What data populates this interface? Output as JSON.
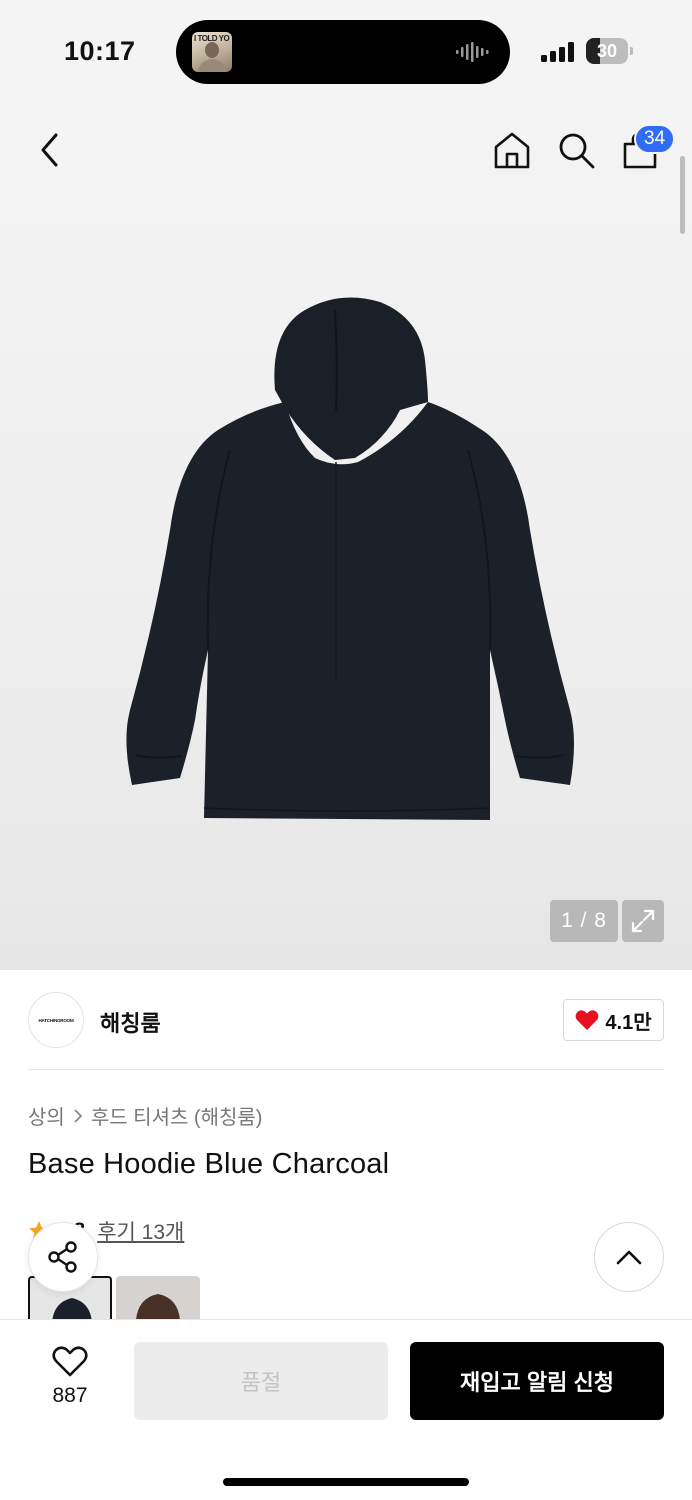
{
  "status_bar": {
    "time": "10:17",
    "battery": "30",
    "now_playing_art_text": "I TOLD YO"
  },
  "header": {
    "cart_count": "34",
    "icons": [
      "back-icon",
      "home-icon",
      "search-icon",
      "bag-icon"
    ]
  },
  "gallery": {
    "counter": "1 / 8",
    "expand_icon": "expand-icon"
  },
  "brand": {
    "logo_text": "HATCHINGROOM",
    "name": "해칭룸",
    "like_count": "4.1만",
    "heart_color": "#e8101e"
  },
  "product": {
    "breadcrumb": [
      "상의",
      "후드 티셔츠 (해칭룸)"
    ],
    "title": "Base Hoodie Blue Charcoal",
    "rating": "4.8",
    "reviews_label": "후기 13개"
  },
  "bottom_bar": {
    "wish_count": "887",
    "soldout_label": "품절",
    "restock_label": "재입고 알림 신청"
  },
  "colors": {
    "badge_blue": "#2f6df5",
    "hoodie": "#1c2129",
    "star": "#f5a623"
  }
}
